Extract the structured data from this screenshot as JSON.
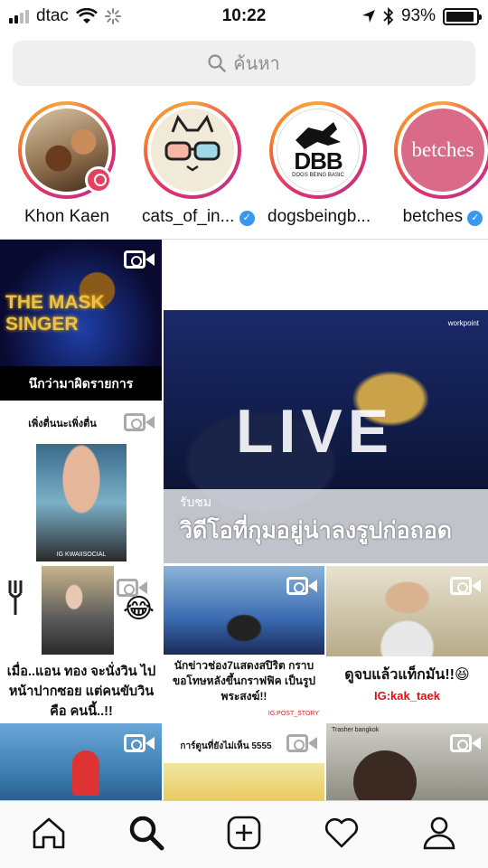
{
  "status_bar": {
    "carrier": "dtac",
    "time": "10:22",
    "battery_percent": "93%",
    "battery_level": 0.93
  },
  "search": {
    "placeholder": "ค้นหา",
    "icon": "search-icon"
  },
  "stories": [
    {
      "name": "Khon Kaen",
      "verified": false,
      "badge": "location-icon"
    },
    {
      "name": "cats_of_in...",
      "verified": true
    },
    {
      "name": "dogsbeingb...",
      "verified": false,
      "logo_text": "DBB",
      "logo_subtext": "DOGS BEING BASIC"
    },
    {
      "name": "betches",
      "verified": true,
      "logo_text": "betches"
    }
  ],
  "grid": {
    "tile1": {
      "banner": "THE MASK SINGER",
      "caption": "นึกว่ามาผิดรายการ"
    },
    "tile2": {
      "caption_top": "เพิ่งตื่นนะเพิ่งตื่น",
      "watermark": "IG KWAIISOCIAL"
    },
    "tile3": {
      "title": "LIVE",
      "overlay_small": "รับชม",
      "overlay_large": "วิดีโอที่กุมอยู่น่าลงรูปก่อถอด",
      "channel": "workpoint"
    },
    "tile4": {
      "caption": "เมื่อ..แอน ทอง จะนั่งวิน ไปหน้าปากซอย แต่คนขับวิน คือ คนนี้..!!",
      "emoji": "😂"
    },
    "tile5": {
      "caption": "นักข่าวช่อง7แสดงสปิริต กราบขอโทษหลังขึ้นกราฟฟิค เป็นรูปพระสงฆ์!!",
      "source": "IG:POST_STORY"
    },
    "tile6": {
      "caption": "ดูจบแล้วแท็กมัน!!",
      "emoji": "😆",
      "handle": "IG:kak_taek"
    },
    "tile8": {
      "caption": "การ์ตูนที่ยังไม่เห็น 5555"
    },
    "tile9": {
      "source": "Trasher bangkok"
    }
  },
  "tabbar": {
    "items": [
      "home-icon",
      "search-icon",
      "new-post-icon",
      "activity-heart-icon",
      "profile-icon"
    ],
    "active": "search-icon"
  }
}
